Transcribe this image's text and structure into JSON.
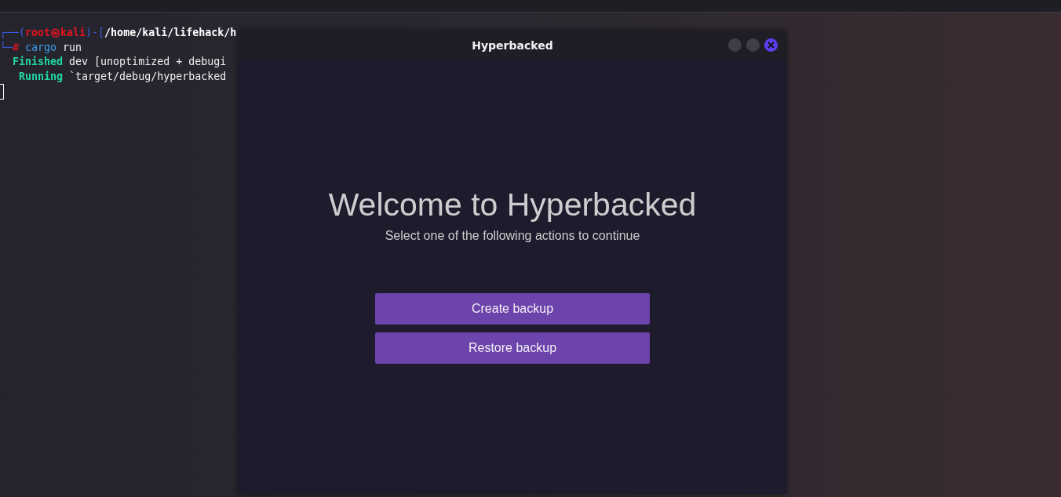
{
  "terminal": {
    "lines": [
      {
        "segments": [
          {
            "kind": "frame",
            "text": "┌──("
          },
          {
            "kind": "user",
            "text": "root㉿kali"
          },
          {
            "kind": "frame",
            "text": ")-["
          },
          {
            "kind": "path",
            "text": "/home/kali/lifehack/h"
          }
        ]
      },
      {
        "segments": [
          {
            "kind": "frame",
            "text": "└─"
          },
          {
            "kind": "prompt",
            "text": "#"
          },
          {
            "kind": "command",
            "text": " cargo"
          },
          {
            "kind": "plain",
            "text": " run"
          }
        ]
      },
      {
        "segments": [
          {
            "kind": "status",
            "text": "  Finished"
          },
          {
            "kind": "plain",
            "text": " dev [unoptimized + debugi"
          }
        ]
      },
      {
        "segments": [
          {
            "kind": "status",
            "text": "   Running"
          },
          {
            "kind": "plain",
            "text": " `target/debug/hyperbacked"
          }
        ]
      }
    ],
    "cursor": true
  },
  "window": {
    "title": "Hyperbacked",
    "controls": [
      {
        "kind": "minimize"
      },
      {
        "kind": "maximize"
      },
      {
        "kind": "close"
      }
    ]
  },
  "welcome": {
    "heading": "Welcome to Hyperbacked",
    "subtitle": "Select one of the following actions to continue"
  },
  "buttons": [
    "Create backup",
    "Restore backup"
  ]
}
